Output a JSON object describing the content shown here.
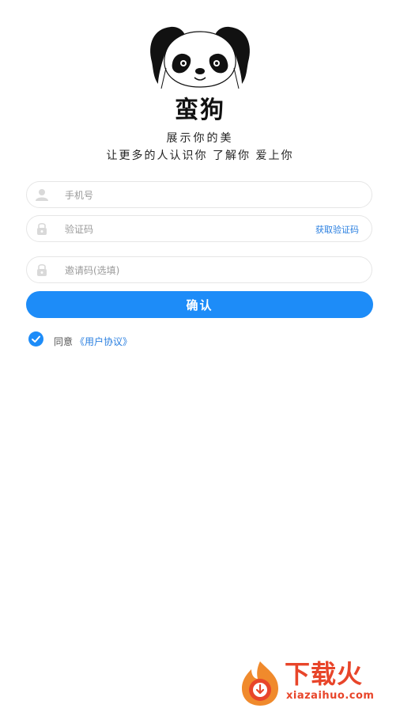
{
  "app": {
    "name": "蛮狗",
    "slogan_line1": "展示你的美",
    "slogan_line2": "让更多的人认识你 了解你 爱上你"
  },
  "form": {
    "phone": {
      "placeholder": "手机号",
      "value": ""
    },
    "code": {
      "placeholder": "验证码",
      "value": "",
      "get_code_label": "获取验证码"
    },
    "invite": {
      "placeholder": "邀请码(选填)",
      "value": ""
    },
    "confirm_label": "确认",
    "agreement": {
      "checked": true,
      "prefix": "同意",
      "link_label": "《用户协议》"
    }
  },
  "watermark": {
    "cn": "下载火",
    "en": "xiazaihuo.com"
  },
  "colors": {
    "primary": "#1d8cf8",
    "link": "#2a7fe0",
    "border": "#e6e6e6",
    "watermark": "#e8452a"
  }
}
